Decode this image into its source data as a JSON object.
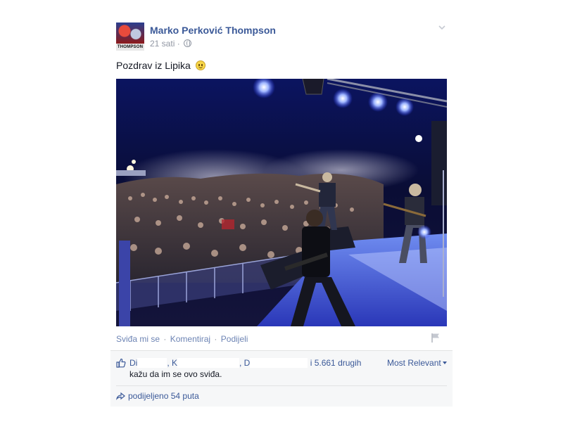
{
  "post": {
    "author": "Marko Perković Thompson",
    "avatar_text": "THOMPSON",
    "time": "21 sati",
    "visibility_icon": "globe-icon",
    "message": "Pozdrav iz Lipika",
    "emoji": "smiley-emoji-icon"
  },
  "actions": {
    "like": "Sviđa mi se",
    "comment": "Komentiraj",
    "share": "Podijeli",
    "separator": "·"
  },
  "likes": {
    "liker_1": "Di",
    "liker_2": ", K",
    "liker_3": ", D",
    "others": "i 5.661 drugih",
    "line2": "kažu da im se ovo sviđa.",
    "sort_label": "Most Relevant"
  },
  "shares": {
    "label": "podijeljeno 54 puta"
  },
  "colors": {
    "link": "#3b5998",
    "action_link": "#6d84b4",
    "meta": "#9197a3",
    "ufi_bg": "#f6f7f8"
  }
}
